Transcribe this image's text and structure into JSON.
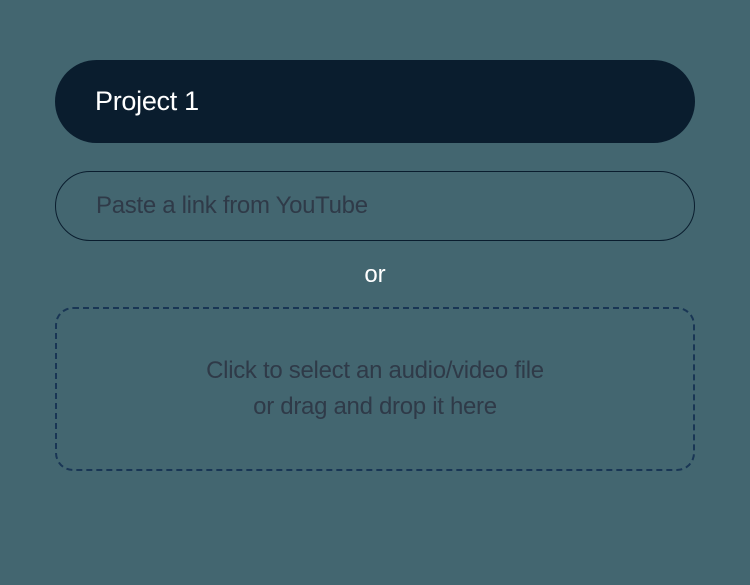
{
  "project": {
    "title": "Project 1"
  },
  "link_input": {
    "placeholder": "Paste a link from YouTube"
  },
  "separator": {
    "label": "or"
  },
  "dropzone": {
    "line1": "Click to select an audio/video file",
    "line2": "or  drag and drop it here"
  }
}
